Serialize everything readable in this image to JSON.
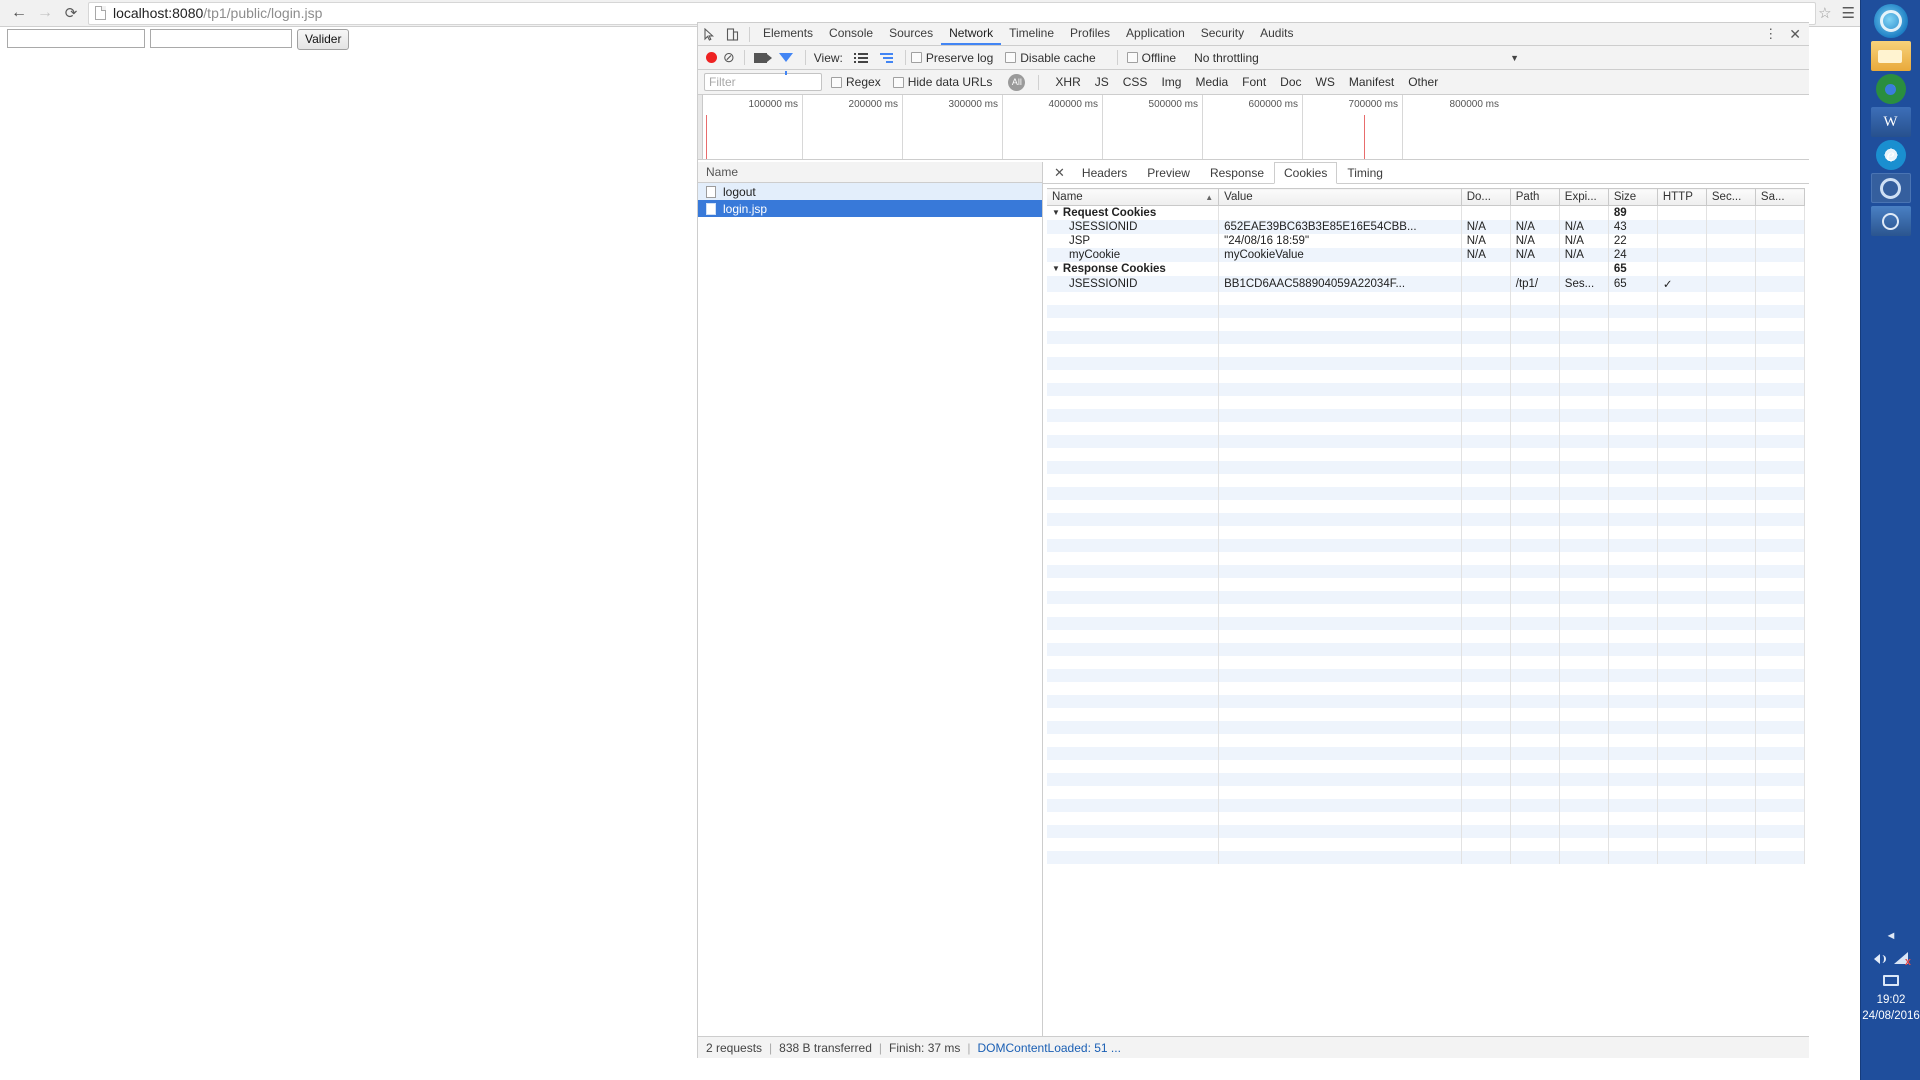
{
  "browser": {
    "back_icon": "arrow-left-icon",
    "forward_icon": "arrow-right-icon",
    "reload_icon": "reload-icon",
    "page_icon": "page-document-icon",
    "url_host": "localhost:8080",
    "url_path": "/tp1/public/login.jsp",
    "star_icon": "☆",
    "menu_icon": "☰"
  },
  "page": {
    "field1_value": "",
    "field1_placeholder": "",
    "field2_value": "",
    "field2_placeholder": "",
    "submit_label": "Valider"
  },
  "devtools": {
    "inspect_icon": "inspect-cursor-icon",
    "device_icon": "device-toolbar-icon",
    "kebab_icon": "⋮",
    "close_icon": "✕",
    "tabs": [
      {
        "label": "Elements",
        "active": false
      },
      {
        "label": "Console",
        "active": false
      },
      {
        "label": "Sources",
        "active": false
      },
      {
        "label": "Network",
        "active": true
      },
      {
        "label": "Timeline",
        "active": false
      },
      {
        "label": "Profiles",
        "active": false
      },
      {
        "label": "Application",
        "active": false
      },
      {
        "label": "Security",
        "active": false
      },
      {
        "label": "Audits",
        "active": false
      }
    ],
    "toolbar": {
      "record_icon": "record-circle-icon",
      "clear_icon": "⊘",
      "capture_screenshots_icon": "camera-icon",
      "filter_icon": "funnel-icon",
      "view_label": "View:",
      "view_list_icon": "list-view-icon",
      "view_waterfall_icon": "waterfall-view-icon",
      "preserve_log": "Preserve log",
      "disable_cache": "Disable cache",
      "offline": "Offline",
      "throttling": "No throttling",
      "throttle_caret": "▼"
    },
    "filterbar": {
      "filter_placeholder": "Filter",
      "filter_value": "",
      "regex_label": "Regex",
      "hide_data_urls_label": "Hide data URLs",
      "types": [
        "All",
        "XHR",
        "JS",
        "CSS",
        "Img",
        "Media",
        "Font",
        "Doc",
        "WS",
        "Manifest",
        "Other"
      ],
      "active_type": "All"
    },
    "overview": {
      "ticks": [
        "100000 ms",
        "200000 ms",
        "300000 ms",
        "400000 ms",
        "500000 ms",
        "600000 ms",
        "700000 ms",
        "800000 ms"
      ]
    },
    "requests": {
      "column_header": "Name",
      "rows": [
        {
          "name": "logout",
          "selected": false
        },
        {
          "name": "login.jsp",
          "selected": true
        }
      ]
    },
    "detail_tabs": [
      {
        "label": "Headers",
        "active": false
      },
      {
        "label": "Preview",
        "active": false
      },
      {
        "label": "Response",
        "active": false
      },
      {
        "label": "Cookies",
        "active": true
      },
      {
        "label": "Timing",
        "active": false
      }
    ],
    "cookies_table": {
      "columns": [
        "Name",
        "Value",
        "Do...",
        "Path",
        "Expi...",
        "Size",
        "HTTP",
        "Sec...",
        "Sa..."
      ],
      "sort_column": "Name",
      "sort_arrow": "▲",
      "groups": [
        {
          "title": "Request Cookies",
          "size": "89",
          "rows": [
            {
              "name": "JSESSIONID",
              "value": "652EAE39BC63B3E85E16E54CBB...",
              "domain": "N/A",
              "path": "N/A",
              "expires": "N/A",
              "size": "43",
              "http": "",
              "secure": "",
              "samesite": ""
            },
            {
              "name": "JSP",
              "value": "\"24/08/16 18:59\"",
              "domain": "N/A",
              "path": "N/A",
              "expires": "N/A",
              "size": "22",
              "http": "",
              "secure": "",
              "samesite": ""
            },
            {
              "name": "myCookie",
              "value": "myCookieValue",
              "domain": "N/A",
              "path": "N/A",
              "expires": "N/A",
              "size": "24",
              "http": "",
              "secure": "",
              "samesite": ""
            }
          ]
        },
        {
          "title": "Response Cookies",
          "size": "65",
          "rows": [
            {
              "name": "JSESSIONID",
              "value": "BB1CD6AAC588904059A22034F...",
              "domain": "",
              "path": "/tp1/",
              "expires": "Ses...",
              "size": "65",
              "http": "✓",
              "secure": "",
              "samesite": ""
            }
          ]
        }
      ]
    },
    "status": {
      "requests": "2 requests",
      "transferred": "838 B transferred",
      "finish": "Finish: 37 ms",
      "domcontentloaded": "DOMContentLoaded: 51 ..."
    }
  },
  "taskbar": {
    "items": [
      {
        "icon": "windows-start-icon",
        "name": "start-button"
      },
      {
        "icon": "file-explorer-icon",
        "name": "file-explorer"
      },
      {
        "icon": "chrome-icon",
        "name": "google-chrome"
      },
      {
        "icon": "word-icon",
        "name": "microsoft-word"
      },
      {
        "icon": "internet-explorer-icon",
        "name": "internet-explorer"
      },
      {
        "icon": "settings-icon",
        "name": "settings"
      },
      {
        "icon": "camera-icon",
        "name": "camera-app"
      }
    ],
    "collapse_icon": "◄",
    "volume_icon": "volume-icon",
    "network_icon": "network-error-icon",
    "network_badge": "x",
    "display_icon": "display-icon",
    "time": "19:02",
    "date": "24/08/2016"
  },
  "colors": {
    "accent": "#4285f4",
    "selection": "#3879d9",
    "alt_row": "#e3eefb",
    "taskbar": "#1f4e9c",
    "record": "#e22222"
  }
}
